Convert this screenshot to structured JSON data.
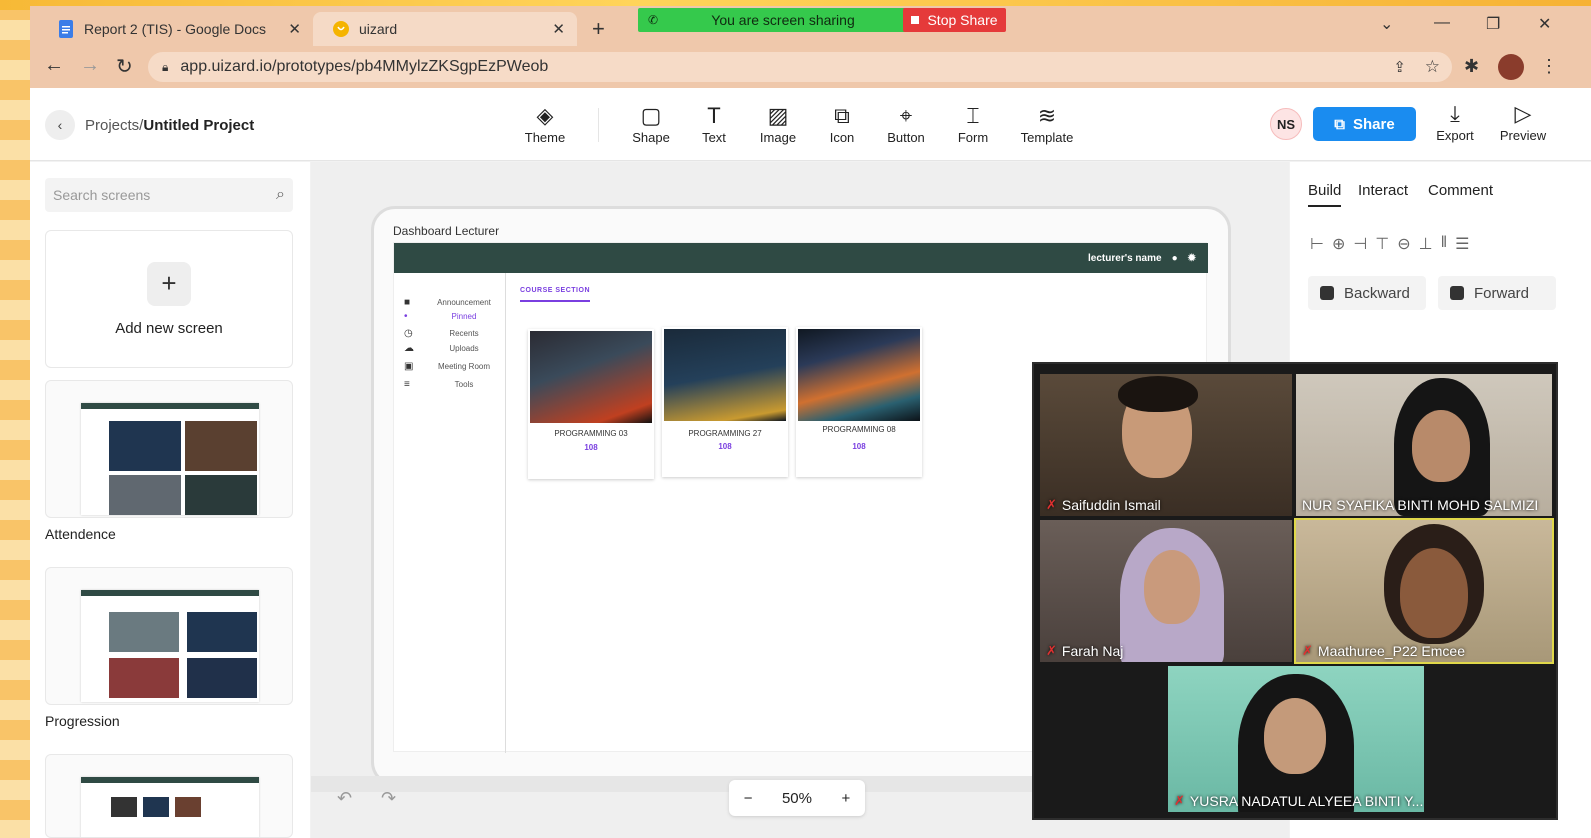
{
  "browser": {
    "tabs": [
      {
        "label": "Report 2 (TIS) - Google Docs",
        "icon": "docs-icon"
      },
      {
        "label": "uizard",
        "icon": "uizard-icon"
      }
    ],
    "sharing_label": "You are screen sharing",
    "stop_share_label": "Stop Share",
    "url": "app.uizard.io/prototypes/pb4MMylzZKSgpEzPWeob"
  },
  "appbar": {
    "breadcrumb_root": "Projects/",
    "breadcrumb_current": "Untitled Project",
    "tools": [
      "Theme",
      "Shape",
      "Text",
      "Image",
      "Icon",
      "Button",
      "Form",
      "Template"
    ],
    "user_initials": "NS",
    "share_label": "Share",
    "export_label": "Export",
    "preview_label": "Preview"
  },
  "left_panel": {
    "search_placeholder": "Search screens",
    "add_screen_label": "Add new screen",
    "screens": [
      "Attendence",
      "Progression"
    ]
  },
  "canvas": {
    "frame_title": "Dashboard Lecturer",
    "topbar_user": "lecturer's name",
    "sidebar": [
      "Announcement",
      "Pinned",
      "Recents",
      "Uploads",
      "Meeting Room",
      "Tools"
    ],
    "course_section_label": "COURSE SECTION",
    "courses": [
      {
        "title": "PROGRAMMING 03",
        "code": "108"
      },
      {
        "title": "PROGRAMMING 27",
        "code": "108"
      },
      {
        "title": "PROGRAMMING 08",
        "code": "108"
      }
    ],
    "zoom": "50%"
  },
  "right_panel": {
    "tabs": [
      "Build",
      "Interact",
      "Comment"
    ],
    "backward_label": "Backward",
    "forward_label": "Forward"
  },
  "meeting": {
    "participants": [
      "Saifuddin Ismail",
      "NUR SYAFIKA BINTI MOHD SALMIZI",
      "Farah Naj",
      "Maathuree_P22 Emcee",
      "YUSRA NADATUL ALYEEA BINTI Y..."
    ]
  },
  "colors": {
    "accent": "#1a8cf0",
    "share_green": "#35c94c",
    "stop_red": "#e53a3a",
    "app_topbar": "#2f4a44",
    "purple": "#7a3fe0"
  }
}
